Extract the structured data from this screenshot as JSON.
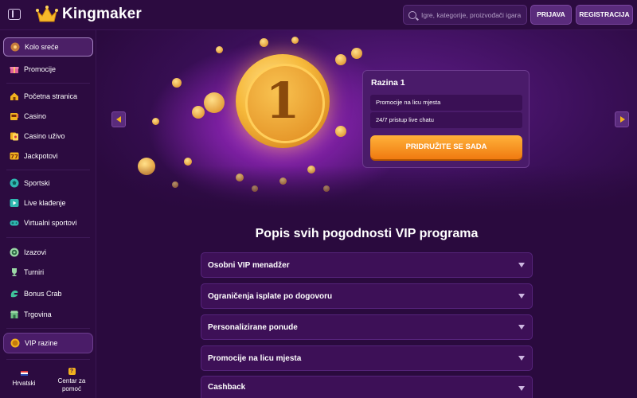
{
  "header": {
    "brand": "Kingmaker",
    "search_placeholder": "Igre, kategorije, proizvođači igara",
    "login_label": "PRIJAVA",
    "register_label": "REGISTRACIJA"
  },
  "sidebar": {
    "items": [
      {
        "label": "Kolo sreće",
        "icon": "wheel-icon"
      },
      {
        "label": "Promocije",
        "icon": "gift-icon"
      },
      {
        "label": "Početna stranica",
        "icon": "home-icon"
      },
      {
        "label": "Casino",
        "icon": "slot-machine-icon"
      },
      {
        "label": "Casino uživo",
        "icon": "live-casino-icon"
      },
      {
        "label": "Jackpotovi",
        "icon": "jackpot-icon"
      },
      {
        "label": "Sportski",
        "icon": "soccer-ball-icon"
      },
      {
        "label": "Live klađenje",
        "icon": "play-icon"
      },
      {
        "label": "Virtualni sportovi",
        "icon": "gamepad-icon"
      },
      {
        "label": "Izazovi",
        "icon": "target-icon"
      },
      {
        "label": "Turniri",
        "icon": "trophy-icon"
      },
      {
        "label": "Bonus Crab",
        "icon": "crab-claw-icon"
      },
      {
        "label": "Trgovina",
        "icon": "shop-icon"
      },
      {
        "label": "VIP razine",
        "icon": "vip-coin-icon"
      }
    ],
    "footer": {
      "language": "Hrvatski",
      "help": "Centar za pomoć"
    }
  },
  "hero": {
    "level_title": "Razina 1",
    "perks": [
      "Promocije na licu mjesta",
      "24/7 pristup live chatu"
    ],
    "join_label": "PRIDRUŽITE SE SADA"
  },
  "main": {
    "title": "Popis svih pogodnosti VIP programa",
    "accordion": [
      "Osobni VIP menadžer",
      "Ograničenja isplate po dogovoru",
      "Personalizirane ponude",
      "Promocije na licu mjesta",
      "Cashback"
    ]
  },
  "colors": {
    "background": "#2a0a3e",
    "sidebar": "#2c0b40",
    "accent_gold": "#f2b21e",
    "button_orange": "#f07a10"
  }
}
